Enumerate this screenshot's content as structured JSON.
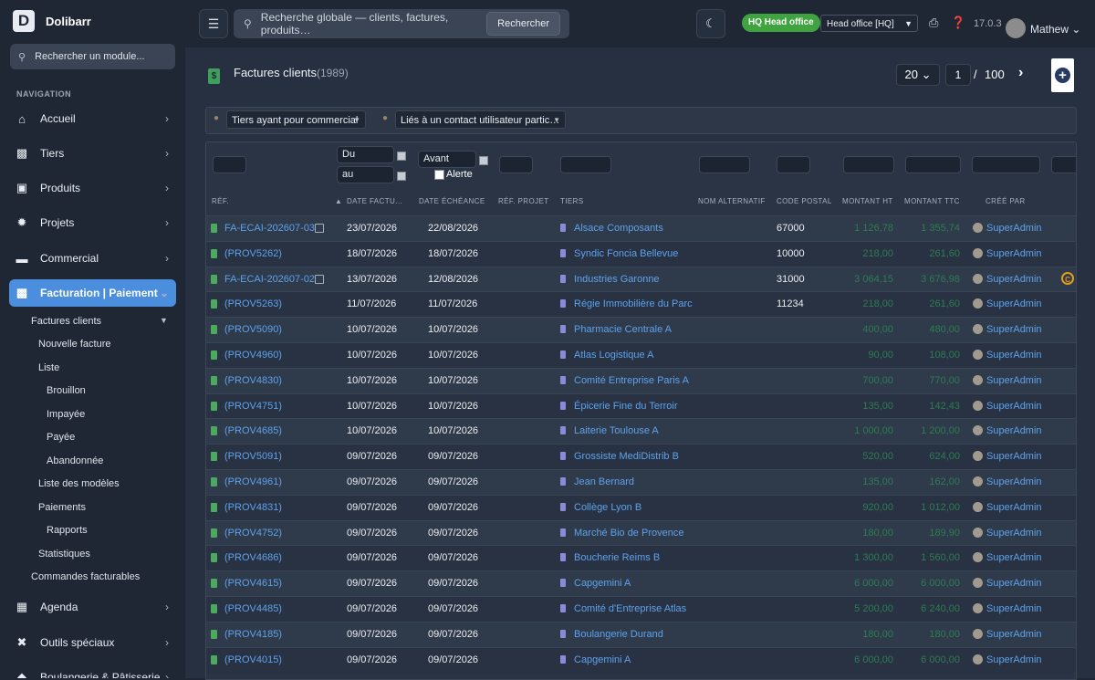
{
  "brand": {
    "name": "Dolibarr",
    "logo_letter": "D"
  },
  "sidebar": {
    "search_placeholder": "Rechercher un module...",
    "nav_heading": "NAVIGATION",
    "items": [
      {
        "label": "Accueil",
        "icon": "home-icon"
      },
      {
        "label": "Tiers",
        "icon": "building-icon"
      },
      {
        "label": "Produits",
        "icon": "box-icon"
      },
      {
        "label": "Projets",
        "icon": "project-icon"
      },
      {
        "label": "Commercial",
        "icon": "briefcase-icon"
      },
      {
        "label": "Facturation | Paiement",
        "icon": "invoice-icon",
        "active": true
      },
      {
        "label": "Agenda",
        "icon": "calendar-icon"
      },
      {
        "label": "Outils spéciaux",
        "icon": "tools-icon"
      },
      {
        "label": "Boulangerie & Pâtisserie",
        "icon": "bakery-icon"
      }
    ],
    "submenu": [
      {
        "label": "Factures clients",
        "level": 1,
        "expanded": true
      },
      {
        "label": "Nouvelle facture",
        "level": 2
      },
      {
        "label": "Liste",
        "level": 2
      },
      {
        "label": "Brouillon",
        "level": 3
      },
      {
        "label": "Impayée",
        "level": 3
      },
      {
        "label": "Payée",
        "level": 3
      },
      {
        "label": "Abandonnée",
        "level": 3
      },
      {
        "label": "Liste des modèles",
        "level": 2
      },
      {
        "label": "Paiements",
        "level": 2
      },
      {
        "label": "Rapports",
        "level": 3
      },
      {
        "label": "Statistiques",
        "level": 2
      },
      {
        "label": "Commandes facturables",
        "level": 1
      }
    ]
  },
  "topbar": {
    "search_placeholder": "Recherche globale — clients, factures, produits…",
    "search_button": "Rechercher",
    "hq_badge": "HQ  Head office",
    "entity_select": "Head office [HQ]",
    "version": "17.0.3",
    "username": "Mathew"
  },
  "page": {
    "title": "Factures clients",
    "count": "(1989)",
    "pager": {
      "limit": "20",
      "page": "1",
      "separator": "/",
      "total": "100"
    }
  },
  "filters": {
    "commercial": "Tiers ayant pour commercial",
    "contact": "Liés à un contact utilisateur partic…"
  },
  "table": {
    "filter_from": "Du",
    "filter_to": "au",
    "filter_due": "Avant",
    "filter_alert": "Alerte",
    "columns": [
      "Réf.",
      "Date factu…",
      "Date échéance",
      "Réf. projet",
      "Tiers",
      "Nom alternatif",
      "Code postal",
      "Montant HT",
      "Montant TTC",
      "Créé par"
    ],
    "rows": [
      {
        "ref": "FA-ECAI-202607-03",
        "note": true,
        "date": "23/07/2026",
        "due": "22/08/2026",
        "tiers": "Alsace Composants",
        "cp": "67000",
        "ht": "1 126,78",
        "ttc": "1 355,74",
        "user": "SuperAdmin"
      },
      {
        "ref": "(PROV5262)",
        "date": "18/07/2026",
        "due": "18/07/2026",
        "tiers": "Syndic Foncia Bellevue",
        "cp": "10000",
        "ht": "218,00",
        "ttc": "261,60",
        "user": "SuperAdmin"
      },
      {
        "ref": "FA-ECAI-202607-02",
        "note": true,
        "date": "13/07/2026",
        "due": "12/08/2026",
        "tiers": "Industries Garonne",
        "cp": "31000",
        "ht": "3 064,15",
        "ttc": "3 676,98",
        "user": "SuperAdmin",
        "status": "C"
      },
      {
        "ref": "(PROV5263)",
        "date": "11/07/2026",
        "due": "11/07/2026",
        "tiers": "Régie Immobilière du Parc",
        "cp": "11234",
        "ht": "218,00",
        "ttc": "261,60",
        "user": "SuperAdmin"
      },
      {
        "ref": "(PROV5090)",
        "date": "10/07/2026",
        "due": "10/07/2026",
        "tiers": "Pharmacie Centrale A",
        "cp": "",
        "ht": "400,00",
        "ttc": "480,00",
        "user": "SuperAdmin"
      },
      {
        "ref": "(PROV4960)",
        "date": "10/07/2026",
        "due": "10/07/2026",
        "tiers": "Atlas Logistique A",
        "cp": "",
        "ht": "90,00",
        "ttc": "108,00",
        "user": "SuperAdmin"
      },
      {
        "ref": "(PROV4830)",
        "date": "10/07/2026",
        "due": "10/07/2026",
        "tiers": "Comité Entreprise Paris A",
        "cp": "",
        "ht": "700,00",
        "ttc": "770,00",
        "user": "SuperAdmin"
      },
      {
        "ref": "(PROV4751)",
        "date": "10/07/2026",
        "due": "10/07/2026",
        "tiers": "Épicerie Fine du Terroir",
        "cp": "",
        "ht": "135,00",
        "ttc": "142,43",
        "user": "SuperAdmin"
      },
      {
        "ref": "(PROV4685)",
        "date": "10/07/2026",
        "due": "10/07/2026",
        "tiers": "Laiterie Toulouse A",
        "cp": "",
        "ht": "1 000,00",
        "ttc": "1 200,00",
        "user": "SuperAdmin"
      },
      {
        "ref": "(PROV5091)",
        "date": "09/07/2026",
        "due": "09/07/2026",
        "tiers": "Grossiste MediDistrib B",
        "cp": "",
        "ht": "520,00",
        "ttc": "624,00",
        "user": "SuperAdmin"
      },
      {
        "ref": "(PROV4961)",
        "date": "09/07/2026",
        "due": "09/07/2026",
        "tiers": "Jean Bernard",
        "cp": "",
        "ht": "135,00",
        "ttc": "162,00",
        "user": "SuperAdmin"
      },
      {
        "ref": "(PROV4831)",
        "date": "09/07/2026",
        "due": "09/07/2026",
        "tiers": "Collège Lyon B",
        "cp": "",
        "ht": "920,00",
        "ttc": "1 012,00",
        "user": "SuperAdmin"
      },
      {
        "ref": "(PROV4752)",
        "date": "09/07/2026",
        "due": "09/07/2026",
        "tiers": "Marché Bio de Provence",
        "cp": "",
        "ht": "180,00",
        "ttc": "189,90",
        "user": "SuperAdmin"
      },
      {
        "ref": "(PROV4686)",
        "date": "09/07/2026",
        "due": "09/07/2026",
        "tiers": "Boucherie Reims B",
        "cp": "",
        "ht": "1 300,00",
        "ttc": "1 560,00",
        "user": "SuperAdmin"
      },
      {
        "ref": "(PROV4615)",
        "date": "09/07/2026",
        "due": "09/07/2026",
        "tiers": "Capgemini A",
        "cp": "",
        "ht": "6 000,00",
        "ttc": "6 000,00",
        "user": "SuperAdmin"
      },
      {
        "ref": "(PROV4485)",
        "date": "09/07/2026",
        "due": "09/07/2026",
        "tiers": "Comité d'Entreprise Atlas",
        "cp": "",
        "ht": "5 200,00",
        "ttc": "6 240,00",
        "user": "SuperAdmin"
      },
      {
        "ref": "(PROV4185)",
        "date": "09/07/2026",
        "due": "09/07/2026",
        "tiers": "Boulangerie Durand",
        "cp": "",
        "ht": "180,00",
        "ttc": "180,00",
        "user": "SuperAdmin"
      },
      {
        "ref": "(PROV4015)",
        "date": "09/07/2026",
        "due": "09/07/2026",
        "tiers": "Capgemini A",
        "cp": "",
        "ht": "6 000,00",
        "ttc": "6 000,00",
        "user": "SuperAdmin"
      }
    ]
  }
}
